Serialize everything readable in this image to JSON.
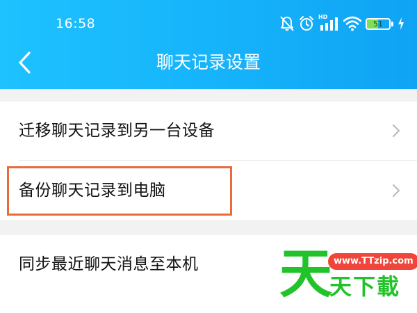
{
  "status_bar": {
    "time": "16:58",
    "icons": [
      "bell-off-icon",
      "alarm-icon",
      "hd-signal-icon",
      "wifi-icon",
      "battery-icon",
      "charging-icon"
    ],
    "signal_label": "HD",
    "battery_level": "51",
    "battery_fraction": 0.51,
    "battery_color": "#7ee058"
  },
  "nav": {
    "back_icon": "chevron-left-icon",
    "title": "聊天记录设置"
  },
  "settings": {
    "items": [
      {
        "label": "迁移聊天记录到另一台设备",
        "icon": "chevron-right-icon"
      },
      {
        "label": "备份聊天记录到电脑",
        "icon": "chevron-right-icon"
      },
      {
        "label": "同步最近聊天消息至本机"
      }
    ]
  },
  "highlight": {
    "color": "#e86b3e"
  },
  "watermark": {
    "big_char": "天",
    "url": "www.TTzip.com",
    "text": "天下載"
  },
  "colors": {
    "header_start": "#1ec2ff",
    "header_end": "#0fa3f4",
    "background": "#f2f2f2",
    "accent_watermark": "#22c32a"
  }
}
